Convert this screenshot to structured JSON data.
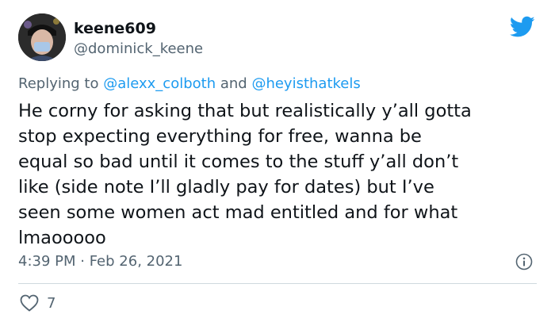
{
  "tweet": {
    "display_name": "keene609",
    "handle": "@dominick_keene",
    "reply_prefix": "Replying to ",
    "reply_mention_1": "@alexx_colboth",
    "reply_and": " and ",
    "reply_mention_2": "@heyisthatkels",
    "text": "He corny for asking that but realistically y’all gotta\nstop expecting everything for free, wanna be\nequal so bad until it comes to the stuff y’all don’t\nlike (side note I’ll gladly pay for dates) but I’ve\nseen some women act mad entitled and for what\nlmaooooo",
    "timestamp": "4:39 PM · Feb 26, 2021",
    "like_count": "7"
  },
  "colors": {
    "brand": "#1d9bf0",
    "muted": "#536471",
    "text": "#0f1419"
  },
  "icons": [
    "twitter-bird-icon",
    "info-icon",
    "heart-icon"
  ]
}
